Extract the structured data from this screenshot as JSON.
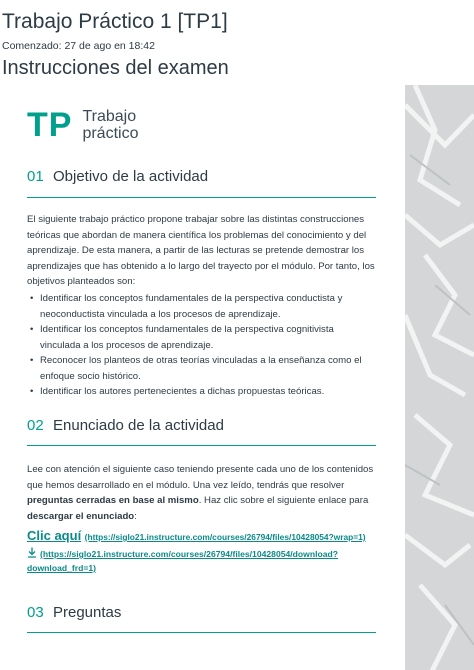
{
  "header": {
    "title": "Trabajo Práctico 1 [TP1]",
    "started": "Comenzado: 27 de ago en 18:42",
    "section": "Instrucciones del examen"
  },
  "logo": {
    "mark": "TP",
    "line1": "Trabajo",
    "line2": "práctico"
  },
  "sections": [
    {
      "num": "01",
      "title": "Objetivo de la actividad"
    },
    {
      "num": "02",
      "title": "Enunciado de la actividad"
    },
    {
      "num": "03",
      "title": "Preguntas"
    }
  ],
  "objective": {
    "paragraph": "El siguiente trabajo práctico propone trabajar sobre las distintas construcciones teóricas que abordan de manera científica los problemas del conocimiento y del aprendizaje. De esta manera, a partir de las lecturas se pretende demostrar los aprendizajes que has obtenido a lo largo del trayecto por el módulo. Por tanto, los objetivos planteados son:",
    "items": [
      "Identificar los conceptos fundamentales de la perspectiva conductista y neoconductista vinculada a los procesos de aprendizaje.",
      "Identificar los conceptos fundamentales de la perspectiva cognitivista vinculada a los procesos de aprendizaje.",
      "Reconocer los planteos de otras teorías vinculadas a la enseñanza como el enfoque socio histórico.",
      "Identificar los autores pertenecientes a dichas propuestas teóricas."
    ]
  },
  "statement": {
    "text_1": "Lee con atención el siguiente caso teniendo presente cada uno de los contenidos que hemos desarrollado en el módulo. Una vez leído, tendrás que resolver ",
    "bold_1": "preguntas cerradas en base al mismo",
    "text_2": ". Haz clic sobre el siguiente enlace para ",
    "bold_2": "descargar el enunciado",
    "text_3": ":",
    "link_label": "Clic aquí",
    "link_url": "(https://siglo21.instructure.com/courses/26794/files/10428054?wrap=1)",
    "download_url": "(https://siglo21.instructure.com/courses/26794/files/10428054/download?download_frd=1)"
  }
}
